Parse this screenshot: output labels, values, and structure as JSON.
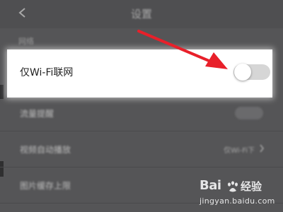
{
  "header": {
    "title": "设置",
    "back_icon": "arrow-left-icon"
  },
  "section": {
    "label": "网络"
  },
  "highlight": {
    "label": "仅Wi-Fi联网",
    "toggle_state": "off",
    "toggle_knob_color": "#ffffff",
    "toggle_track_color": "#d6d6d6"
  },
  "rows": [
    {
      "label": "流量提醒",
      "value": "",
      "control": "toggle"
    },
    {
      "label": "视频自动播放",
      "value": "仅Wi-Fi下",
      "control": "chevron"
    },
    {
      "label": "图片缓存上限",
      "value": "",
      "control": "none"
    }
  ],
  "annotation": {
    "arrow_color": "#e8202a",
    "arrow_icon": "red-pointer-arrow-icon"
  },
  "watermark": {
    "brand": "Bai",
    "brand_zh": "经验",
    "url": "jingyan.baidu.com",
    "icon": "baidu-paw-icon"
  }
}
